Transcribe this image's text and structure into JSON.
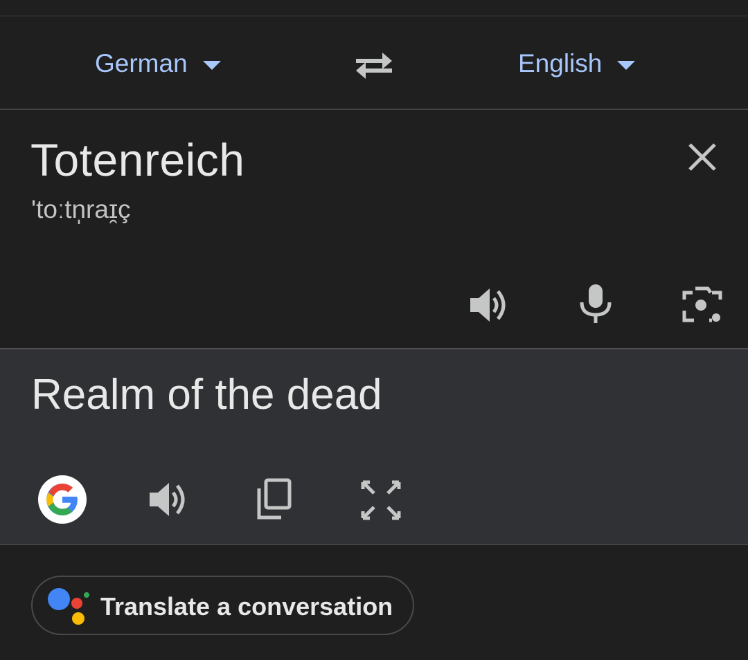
{
  "languages": {
    "source": "German",
    "target": "English"
  },
  "input": {
    "text": "Totenreich",
    "phonetic": "'toːtn̩raɪ̯ç"
  },
  "output": {
    "text": "Realm of the dead"
  },
  "conversation": {
    "label": "Translate a conversation"
  },
  "icons": {
    "swap": "swap-languages-icon",
    "clear": "close-icon",
    "source_speaker": "speaker-icon",
    "microphone": "microphone-icon",
    "camera": "camera-icon",
    "google": "google-g-icon",
    "result_speaker": "speaker-icon",
    "copy": "copy-icon",
    "fullscreen": "fullscreen-icon",
    "assistant": "assistant-icon"
  },
  "colors": {
    "accent": "#a8c7fa",
    "background": "#1f1f20",
    "result_background": "#303134",
    "icon": "#c4c7c5"
  }
}
